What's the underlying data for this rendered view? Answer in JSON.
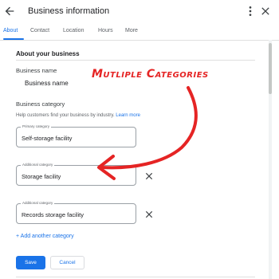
{
  "header": {
    "title": "Business information",
    "back_icon": "arrow-left-icon",
    "more_icon": "more-vert-icon",
    "close_icon": "close-icon"
  },
  "tabs": [
    {
      "label": "About",
      "active": true
    },
    {
      "label": "Contact",
      "active": false
    },
    {
      "label": "Location",
      "active": false
    },
    {
      "label": "Hours",
      "active": false
    },
    {
      "label": "More",
      "active": false
    }
  ],
  "about": {
    "section_title": "About your business",
    "business_name_label": "Business name",
    "business_name_value": "Business name",
    "category_label": "Business category",
    "help_text": "Help customers find your business by industry.",
    "learn_more": "Learn more"
  },
  "categories": {
    "primary": {
      "tag": "Primary category",
      "value": "Self-storage facility"
    },
    "additional": [
      {
        "tag": "Additional category",
        "value": "Storage facility"
      },
      {
        "tag": "Additional category",
        "value": "Records storage facility"
      }
    ],
    "add_label": "+ Add another category"
  },
  "actions": {
    "save": "Save",
    "cancel": "Cancel"
  },
  "annotation": {
    "text": "Mutliple Categories",
    "color": "#e52424"
  },
  "colors": {
    "accent": "#1a73e8",
    "annotation": "#e52424"
  }
}
